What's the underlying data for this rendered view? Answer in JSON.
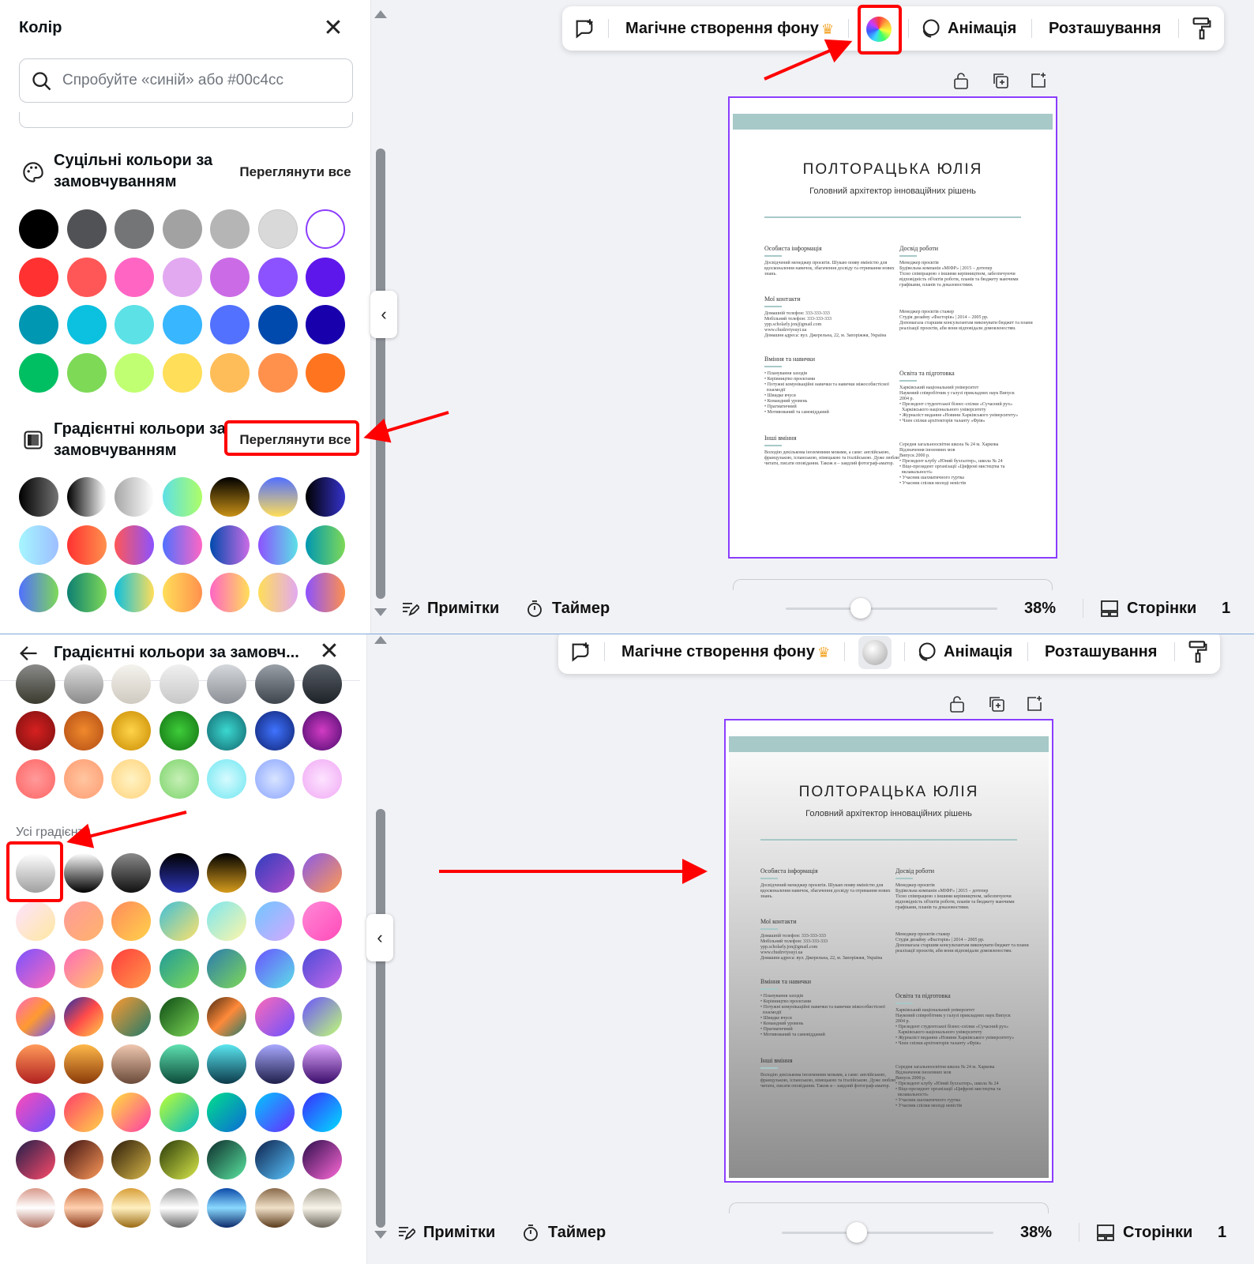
{
  "colors": {
    "accent": "#8b3dff",
    "annotation": "#ff0000",
    "resume_band": "#a7c9c8"
  },
  "top": {
    "panel": {
      "title": "Колір",
      "search_placeholder": "Спробуйте «синій» або #00c4cc",
      "solid_section_title": "Суцільні кольори за замовчуванням",
      "solid_see_all": "Переглянути все",
      "gradient_section_title": "Градієнтні кольори за замовчуванням",
      "gradient_see_all": "Переглянути все",
      "solid_swatches": [
        "#000000",
        "#505255",
        "#737577",
        "#a2a2a2",
        "#b5b5b5",
        "#d9d9d9",
        "#ffffff",
        "#ff3131",
        "#ff5757",
        "#ff66c4",
        "#e2a9f1",
        "#cb6ce6",
        "#8c52ff",
        "#5e17eb",
        "#0097b2",
        "#0cc0df",
        "#5ce1e6",
        "#38b6ff",
        "#5271ff",
        "#004aad",
        "#1800ad",
        "#00bf63",
        "#7ed957",
        "#c1ff72",
        "#ffde59",
        "#ffbd59",
        "#ff914d",
        "#ff751f"
      ],
      "gradient_swatches": [
        "linear-gradient(90deg,#000000,#737373)",
        "linear-gradient(90deg,#000000,#ffffff)",
        "linear-gradient(90deg,#a6a6a6,#ffffff)",
        "linear-gradient(90deg,#5de0e6,#aefe66)",
        "linear-gradient(180deg,#000000,#c89116)",
        "linear-gradient(180deg,#5170ff,#ffde59)",
        "linear-gradient(90deg,#000000,#3533cd)",
        "linear-gradient(90deg,#a6f6ff,#9dbeff)",
        "linear-gradient(90deg,#ff3131,#ff914d)",
        "linear-gradient(90deg,#ff5757,#8c52ff)",
        "linear-gradient(90deg,#5170ff,#ff66c4)",
        "linear-gradient(90deg,#004aad,#cb6ce6)",
        "linear-gradient(90deg,#8c52ff,#5ce1e6)",
        "linear-gradient(90deg,#0097b2,#7ed957)",
        "linear-gradient(90deg,#5170ff,#7ed957)",
        "linear-gradient(90deg,#0c7f72,#7ed957)",
        "linear-gradient(90deg,#0cc0df,#ffde59)",
        "linear-gradient(90deg,#ffde59,#ff914d)",
        "linear-gradient(90deg,#ff66c4,#ffde59)",
        "linear-gradient(90deg,#ffde59,#e2a9f1)",
        "linear-gradient(90deg,#8c52ff,#ff914d)"
      ]
    },
    "toolbar": {
      "magic_bg": "Магічне створення фону",
      "animation": "Анімація",
      "position": "Розташування",
      "color_button_icon": "rainbow-color-icon"
    },
    "bottom": {
      "notes": "Примітки",
      "timer": "Таймер",
      "zoom": "38%",
      "pages": "Сторінки",
      "trailing": "1",
      "zoom_level": 0.38
    }
  },
  "resume": {
    "name": "ПОЛТОРАЦЬКА ЮЛІЯ",
    "subtitle": "Головний архітектор інноваційних рішень",
    "left": [
      {
        "heading": "Особиста інформація",
        "lines": [
          "Досвідчений менеджер проєктів. Шукаю появу вміністю для",
          "вдосконалення навичок, збагачення досвіду та отримання нових",
          "знань."
        ]
      },
      {
        "heading": "Мої контакти",
        "lines": [
          "Домашній телефон: 333-333-333",
          "Мобільний телефон: 333-333-333",
          "ypp.scholarly.jon@gmail.com",
          "www.chudzvtysuyi.ua",
          "Домашня адреса: вул. Джерельна, 22, м. Запоріжжя, Україна"
        ]
      },
      {
        "heading": "Вміння та навички",
        "lines": [
          "• Планування заходів",
          "• Керівництво проєктами",
          "• Потужні комунікаційні навички та навички міжособистісної",
          "  взаємодії",
          "• Швидке вчуся",
          "• Командний уровень",
          "• Прагматичний",
          "• Мотивований та самовідданий"
        ]
      },
      {
        "heading": "Інші вміння",
        "lines": [
          "Володію декількома іноземними мовами, а саме: англійською,",
          "французькою, іспанською, німецькою та італійською. Дуже люблю",
          "читати, писати оповідання. Також я – заядлий фотограф-аматор."
        ]
      }
    ],
    "right": [
      {
        "heading": "Досвід роботи",
        "lines": [
          "Менеджер проєктів",
          "Будівельна компанія «МІФР» | 2015 – дотепер",
          "Тісно співпрацюю з іншими керівництвом, забезпечуючи",
          "відповідність об'єктів роботи, планів та бюджету маючими",
          "графіками, планів та доказовостями."
        ]
      },
      {
        "heading": "",
        "lines": [
          "Менеджер проєктів стажер",
          "Студія дизайну «Фасторія» | 2014 – 2005 рр.",
          "Допомагала старшим консультантам виконувати бюджет та плани",
          "реалізації проєктів, аби вони відповідали домовленостям."
        ]
      },
      {
        "heading": "Освіта та підготовка",
        "lines": [
          "Харківський національний університет",
          "Науковий співробітник у галузі прикладних наук Випуск",
          "2004 р.",
          "• Президент студентської бізнес-спілки «Сучасний рух»",
          "  Харківського національного університету",
          "• Журналіст видання «Новини Харківського університету»",
          "• Член спілки архітекторів таланту «Фрія»"
        ]
      },
      {
        "heading": "",
        "lines": [
          "Середня загальноосвітня школа № 24 м. Харкова",
          "Відзначення іноземних мов",
          "Випуск 2000 р.",
          "• Президент клубу «Юний бухгалтер», школа № 24",
          "• Віце-президент організації «Цифрові мистецтва та",
          "  вклавальності»",
          "• Учасник шахматичного гуртка",
          "• Учасник спілки молоді невістів"
        ]
      }
    ]
  },
  "bottom_half": {
    "panel": {
      "title": "Градієнтні кольори за замовч...",
      "all_gradients_label": "Усі градієнти",
      "partial_row": [
        "linear-gradient(180deg,#8a8a8a,#3a3a2e)",
        "linear-gradient(180deg,#e0e0e0,#8a8a8a)",
        "linear-gradient(180deg,#f5f3ee,#cfcac0)",
        "linear-gradient(180deg,#f0f0f0,#c8c8c8)",
        "linear-gradient(180deg,#d5d8dc,#8c9096)",
        "linear-gradient(180deg,#9aa0a8,#3e444c)",
        "linear-gradient(180deg,#5a6068,#1d2228)"
      ],
      "default_rows": [
        "radial-gradient(circle at 50% 50%,#d62020,#7e1010)",
        "radial-gradient(circle,#f0892c,#b14c14)",
        "radial-gradient(circle,#ffd44a,#c88a00)",
        "radial-gradient(circle,#3ecc3a,#127112)",
        "radial-gradient(circle,#3bd8d0,#12666e)",
        "radial-gradient(circle,#3f73ff,#0f2270)",
        "radial-gradient(circle,#d23cc4,#4b0a6e)",
        "radial-gradient(circle,#ff9a9a,#ff6464)",
        "radial-gradient(circle,#ffc6a0,#ff9a70)",
        "radial-gradient(circle,#fff3c4,#ffd27a)",
        "radial-gradient(circle,#c6efb6,#7bd36a)",
        "radial-gradient(circle,#d6fbff,#6fe6f0)",
        "radial-gradient(circle,#d8e4ff,#8aa4ff)",
        "radial-gradient(circle,#fde3ff,#f0a8f4)"
      ],
      "all_gradients": [
        "linear-gradient(180deg,#ffffff,#a0a0a0)",
        "linear-gradient(180deg,#ffffff,#000000)",
        "linear-gradient(180deg,#8a8a8a,#111111)",
        "linear-gradient(180deg,#000000,#2d35b8)",
        "linear-gradient(180deg,#000000,#d69c1c)",
        "linear-gradient(135deg,#2f3dbf,#b14cc8)",
        "linear-gradient(135deg,#8a5ae8,#ff9a50)",
        "linear-gradient(135deg,#fde3ff,#ffe8a0)",
        "linear-gradient(135deg,#ff9a9a,#ffb36b)",
        "linear-gradient(135deg,#ff8a5c,#ffd24a)",
        "linear-gradient(135deg,#3fbfd8,#ffe26a)",
        "linear-gradient(135deg,#7ce6f0,#fff6a8)",
        "linear-gradient(135deg,#6fc6ff,#d6a8ff)",
        "linear-gradient(135deg,#ff8ad8,#ff4ab8)",
        "linear-gradient(135deg,#7a52ff,#ff6ab8)",
        "linear-gradient(135deg,#ff6ab8,#ffc66a)",
        "linear-gradient(135deg,#ff3c3c,#ff9a4a)",
        "linear-gradient(135deg,#1f9a9a,#7ed957)",
        "linear-gradient(135deg,#2a7ab0,#7ed957)",
        "linear-gradient(135deg,#6a52ff,#5ce1e6)",
        "linear-gradient(135deg,#4a4ad8,#c86ae8)",
        "linear-gradient(135deg,#ff6ab8,#ff9a30,#6a52ff)",
        "linear-gradient(135deg,#1f2fa8,#ff4a4a,#ffd04a)",
        "linear-gradient(135deg,#ff9a30,#1f7a6a)",
        "linear-gradient(135deg,#0c4a14,#7ed957)",
        "linear-gradient(135deg,#4a2a10,#ff8a3a,#1f7a6a)",
        "linear-gradient(135deg,#ff6ab8,#6a52ff)",
        "linear-gradient(135deg,#6a52ff,#c1ff72)",
        "linear-gradient(180deg,#ff9a5a,#b12020)",
        "linear-gradient(180deg,#ffb84a,#8a3a08)",
        "linear-gradient(180deg,#f0c8b0,#6a4a3a)",
        "linear-gradient(180deg,#5ee0b0,#0c4a3a)",
        "linear-gradient(180deg,#5ae6f0,#0c3a4a)",
        "linear-gradient(180deg,#a8a8ff,#1f1f4a)",
        "linear-gradient(180deg,#e0a8ff,#3a0c6a)",
        "linear-gradient(135deg,#ff4ab8,#6a52ff)",
        "linear-gradient(135deg,#ff3c6a,#ffd24a)",
        "linear-gradient(135deg,#ffe03a,#ff3ca8)",
        "linear-gradient(135deg,#c1ff32,#00b8c8)",
        "linear-gradient(135deg,#00e08a,#0c6ad8)",
        "linear-gradient(135deg,#00c8ff,#6a2aff)",
        "linear-gradient(135deg,#3a2aff,#00e0ff)",
        "linear-gradient(135deg,#1f1f4a,#ff4a6a)",
        "linear-gradient(135deg,#3a1010,#ff9a5a)",
        "linear-gradient(135deg,#2a1a08,#d8b84a)",
        "linear-gradient(135deg,#2a3a08,#d8e84a)",
        "linear-gradient(135deg,#0c2a2a,#5ae6a0)",
        "linear-gradient(135deg,#0c1f4a,#5ac6ff)",
        "linear-gradient(135deg,#2a0c4a,#ff6ad8)",
        "linear-gradient(180deg,#d89a8a,#ffffff 50%,#b07060)",
        "linear-gradient(180deg,#c86a3a,#ffd0b0 50%,#8a3a1a)",
        "linear-gradient(180deg,#d8a03a,#fff0c0 50%,#9a6a10)",
        "linear-gradient(180deg,#9a9a9a,#ffffff 50%,#6a6a6a)",
        "linear-gradient(180deg,#0c4aa8,#8ad8ff 50%,#0c2a6a)",
        "linear-gradient(180deg,#8a6a4a,#f0e0c8 50%,#5a3a1a)",
        "linear-gradient(180deg,#a09a8a,#f8f4ea 50%,#6a645a)"
      ]
    },
    "toolbar": {
      "magic_bg": "Магічне створення фону",
      "animation": "Анімація",
      "position": "Розташування",
      "color_button_icon": "gray-gradient-color-icon"
    },
    "bottom": {
      "notes": "Примітки",
      "timer": "Таймер",
      "zoom": "38%",
      "pages": "Сторінки",
      "trailing": "1",
      "zoom_level": 0.38
    },
    "page_background": "linear-gradient(180deg,#ffffff 0%,#dcdcdc 35%,#8c8c8c 100%)"
  }
}
